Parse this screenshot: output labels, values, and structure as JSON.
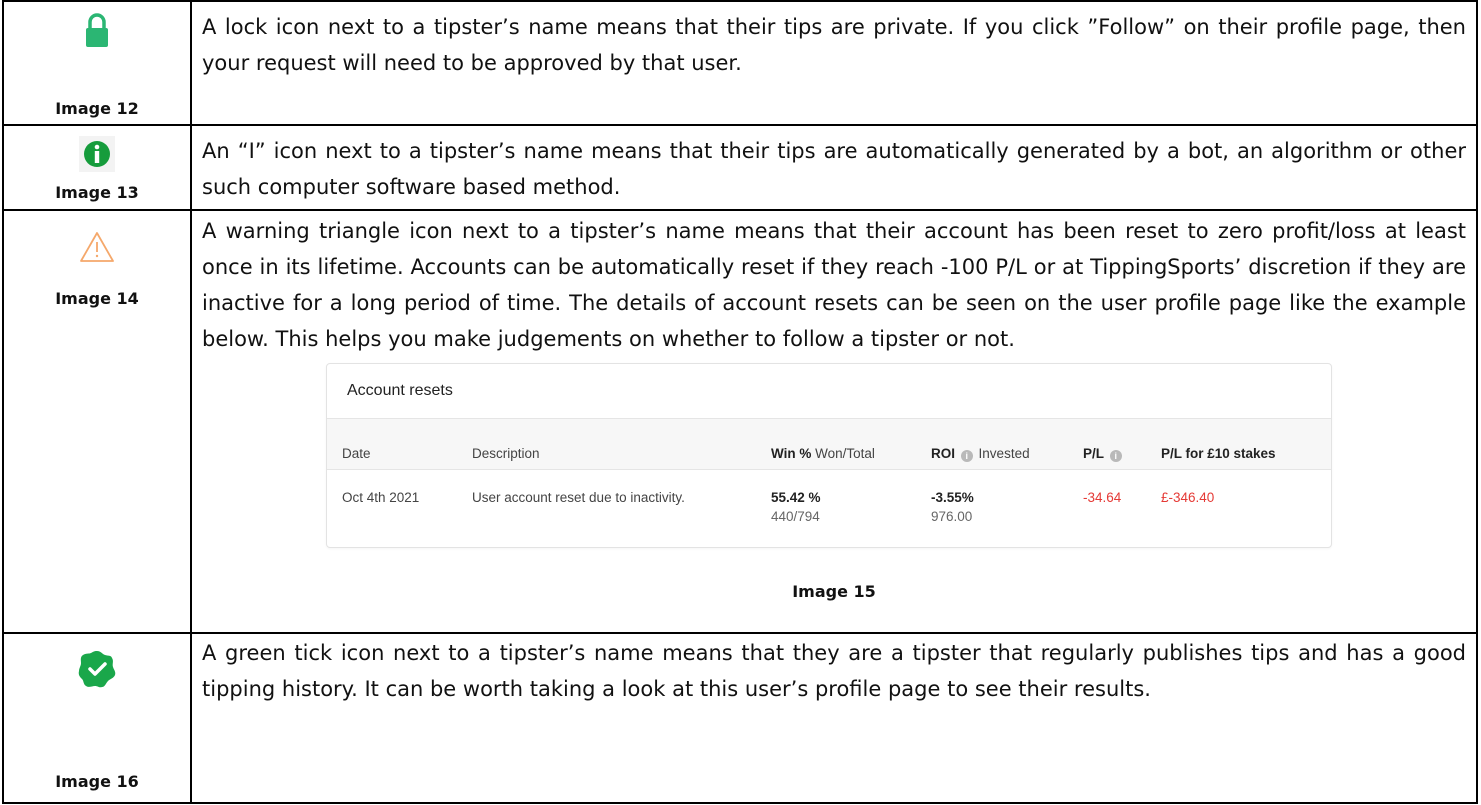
{
  "colors": {
    "lock_green": "#2bb673",
    "info_green": "#169c3c",
    "warning_orange": "#f5a86b",
    "tick_green": "#1aa74a",
    "negative_red": "#e53935"
  },
  "rows": [
    {
      "icon": "lock-icon",
      "caption": "Image 12",
      "text": "A lock icon next to a tipster’s name means that their tips are private. If you click ”Follow” on their profile page, then your request will need to be approved by that user."
    },
    {
      "icon": "info-icon",
      "caption": "Image 13",
      "text": "An “I” icon next to a tipster’s name means that their tips are automatically generated by a bot, an algorithm or other such computer software based method."
    },
    {
      "icon": "warning-icon",
      "caption": "Image 14",
      "text": "A warning triangle icon next to a tipster’s name means that their account has been reset to zero profit/loss at least once in its lifetime. Accounts can be automatically reset if they reach -100 P/L or at TippingSports’ discretion if they are inactive for a long period of time. The details of account resets can be seen on the user profile page like the example below. This helps you make judgements on whether to follow a tipster or not."
    },
    {
      "icon": "verified-tick-icon",
      "caption": "Image 16",
      "text": "A green tick icon next to a tipster’s name means that they are a tipster that regularly publishes tips and has a good tipping history. It can be worth taking a look at this user’s profile page to see their results."
    }
  ],
  "resets": {
    "title": "Account resets",
    "caption": "Image 15",
    "headers": {
      "date": "Date",
      "description": "Description",
      "win_bold": "Win %",
      "win_rest": "Won/Total",
      "roi_bold": "ROI",
      "roi_rest": "Invested",
      "pl": "P/L",
      "pl10": "P/L for £10 stakes"
    },
    "row": {
      "date": "Oct 4th 2021",
      "description": "User account reset due to inactivity.",
      "win_pct": "55.42 %",
      "won_total": "440/794",
      "roi": "-3.55%",
      "invested": "976.00",
      "pl": "-34.64",
      "pl10": "£-346.40"
    },
    "info_glyph": "i"
  }
}
